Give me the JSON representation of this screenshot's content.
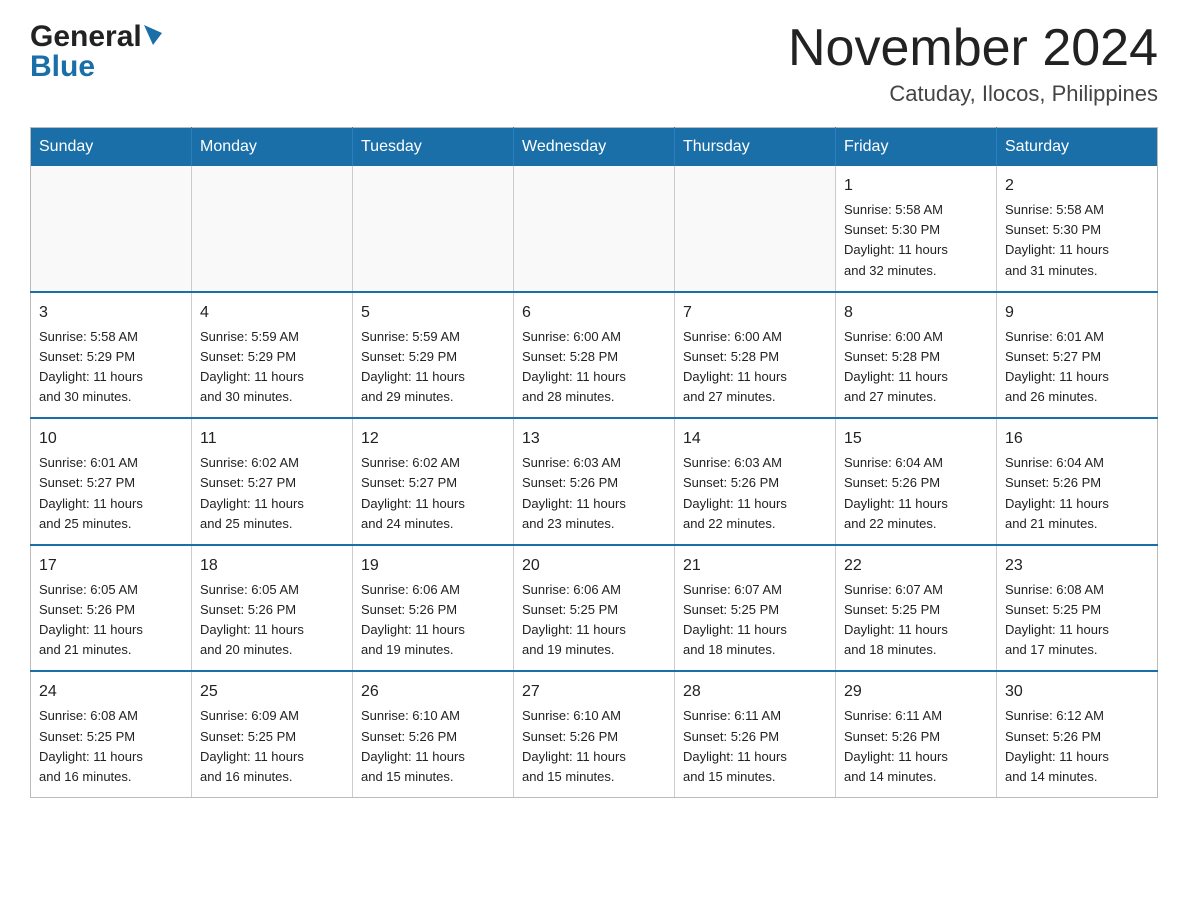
{
  "header": {
    "logo_general": "General",
    "logo_blue": "Blue",
    "month_title": "November 2024",
    "location": "Catuday, Ilocos, Philippines"
  },
  "weekdays": [
    "Sunday",
    "Monday",
    "Tuesday",
    "Wednesday",
    "Thursday",
    "Friday",
    "Saturday"
  ],
  "weeks": [
    [
      {
        "day": "",
        "info": ""
      },
      {
        "day": "",
        "info": ""
      },
      {
        "day": "",
        "info": ""
      },
      {
        "day": "",
        "info": ""
      },
      {
        "day": "",
        "info": ""
      },
      {
        "day": "1",
        "info": "Sunrise: 5:58 AM\nSunset: 5:30 PM\nDaylight: 11 hours\nand 32 minutes."
      },
      {
        "day": "2",
        "info": "Sunrise: 5:58 AM\nSunset: 5:30 PM\nDaylight: 11 hours\nand 31 minutes."
      }
    ],
    [
      {
        "day": "3",
        "info": "Sunrise: 5:58 AM\nSunset: 5:29 PM\nDaylight: 11 hours\nand 30 minutes."
      },
      {
        "day": "4",
        "info": "Sunrise: 5:59 AM\nSunset: 5:29 PM\nDaylight: 11 hours\nand 30 minutes."
      },
      {
        "day": "5",
        "info": "Sunrise: 5:59 AM\nSunset: 5:29 PM\nDaylight: 11 hours\nand 29 minutes."
      },
      {
        "day": "6",
        "info": "Sunrise: 6:00 AM\nSunset: 5:28 PM\nDaylight: 11 hours\nand 28 minutes."
      },
      {
        "day": "7",
        "info": "Sunrise: 6:00 AM\nSunset: 5:28 PM\nDaylight: 11 hours\nand 27 minutes."
      },
      {
        "day": "8",
        "info": "Sunrise: 6:00 AM\nSunset: 5:28 PM\nDaylight: 11 hours\nand 27 minutes."
      },
      {
        "day": "9",
        "info": "Sunrise: 6:01 AM\nSunset: 5:27 PM\nDaylight: 11 hours\nand 26 minutes."
      }
    ],
    [
      {
        "day": "10",
        "info": "Sunrise: 6:01 AM\nSunset: 5:27 PM\nDaylight: 11 hours\nand 25 minutes."
      },
      {
        "day": "11",
        "info": "Sunrise: 6:02 AM\nSunset: 5:27 PM\nDaylight: 11 hours\nand 25 minutes."
      },
      {
        "day": "12",
        "info": "Sunrise: 6:02 AM\nSunset: 5:27 PM\nDaylight: 11 hours\nand 24 minutes."
      },
      {
        "day": "13",
        "info": "Sunrise: 6:03 AM\nSunset: 5:26 PM\nDaylight: 11 hours\nand 23 minutes."
      },
      {
        "day": "14",
        "info": "Sunrise: 6:03 AM\nSunset: 5:26 PM\nDaylight: 11 hours\nand 22 minutes."
      },
      {
        "day": "15",
        "info": "Sunrise: 6:04 AM\nSunset: 5:26 PM\nDaylight: 11 hours\nand 22 minutes."
      },
      {
        "day": "16",
        "info": "Sunrise: 6:04 AM\nSunset: 5:26 PM\nDaylight: 11 hours\nand 21 minutes."
      }
    ],
    [
      {
        "day": "17",
        "info": "Sunrise: 6:05 AM\nSunset: 5:26 PM\nDaylight: 11 hours\nand 21 minutes."
      },
      {
        "day": "18",
        "info": "Sunrise: 6:05 AM\nSunset: 5:26 PM\nDaylight: 11 hours\nand 20 minutes."
      },
      {
        "day": "19",
        "info": "Sunrise: 6:06 AM\nSunset: 5:26 PM\nDaylight: 11 hours\nand 19 minutes."
      },
      {
        "day": "20",
        "info": "Sunrise: 6:06 AM\nSunset: 5:25 PM\nDaylight: 11 hours\nand 19 minutes."
      },
      {
        "day": "21",
        "info": "Sunrise: 6:07 AM\nSunset: 5:25 PM\nDaylight: 11 hours\nand 18 minutes."
      },
      {
        "day": "22",
        "info": "Sunrise: 6:07 AM\nSunset: 5:25 PM\nDaylight: 11 hours\nand 18 minutes."
      },
      {
        "day": "23",
        "info": "Sunrise: 6:08 AM\nSunset: 5:25 PM\nDaylight: 11 hours\nand 17 minutes."
      }
    ],
    [
      {
        "day": "24",
        "info": "Sunrise: 6:08 AM\nSunset: 5:25 PM\nDaylight: 11 hours\nand 16 minutes."
      },
      {
        "day": "25",
        "info": "Sunrise: 6:09 AM\nSunset: 5:25 PM\nDaylight: 11 hours\nand 16 minutes."
      },
      {
        "day": "26",
        "info": "Sunrise: 6:10 AM\nSunset: 5:26 PM\nDaylight: 11 hours\nand 15 minutes."
      },
      {
        "day": "27",
        "info": "Sunrise: 6:10 AM\nSunset: 5:26 PM\nDaylight: 11 hours\nand 15 minutes."
      },
      {
        "day": "28",
        "info": "Sunrise: 6:11 AM\nSunset: 5:26 PM\nDaylight: 11 hours\nand 15 minutes."
      },
      {
        "day": "29",
        "info": "Sunrise: 6:11 AM\nSunset: 5:26 PM\nDaylight: 11 hours\nand 14 minutes."
      },
      {
        "day": "30",
        "info": "Sunrise: 6:12 AM\nSunset: 5:26 PM\nDaylight: 11 hours\nand 14 minutes."
      }
    ]
  ]
}
